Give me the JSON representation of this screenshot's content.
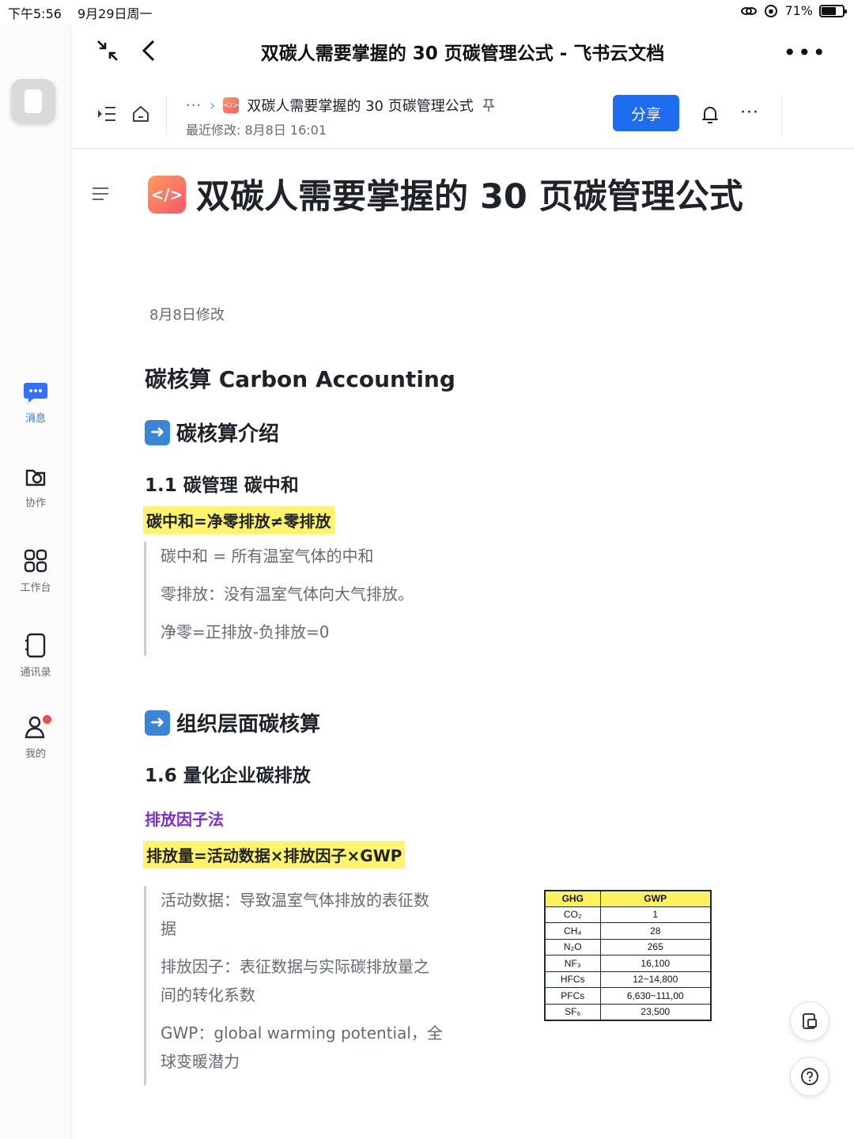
{
  "status_bar": {
    "time": "下午5:56",
    "date": "9月29日周一",
    "battery": "71%",
    "battery_level": 0.71
  },
  "window": {
    "title": "双碳人需要掌握的 30 页碳管理公式 - 飞书云文档"
  },
  "rail": {
    "items": [
      {
        "label": "消息",
        "icon": "message-icon",
        "active": true
      },
      {
        "label": "协作",
        "icon": "collaborate-icon"
      },
      {
        "label": "工作台",
        "icon": "workspace-grid-icon"
      },
      {
        "label": "通讯录",
        "icon": "contacts-icon"
      },
      {
        "label": "我的",
        "icon": "profile-icon",
        "badge": true
      }
    ]
  },
  "toolbar": {
    "breadcrumb_ellipsis": "···",
    "doc_name": "双碳人需要掌握的 30 页碳管理公式",
    "last_modified": "最近修改: 8月8日 16:01",
    "share_label": "分享",
    "more": "···"
  },
  "doc": {
    "icon_text": "</>",
    "title": "双碳人需要掌握的 30 页碳管理公式",
    "date": "8月8日修改",
    "h2": "碳核算 Carbon Accounting",
    "section1": "碳核算介绍",
    "sub11": "1.1 碳管理 碳中和",
    "highlight1": "碳中和=净零排放≠零排放",
    "quote1": [
      "碳中和 = 所有温室气体的中和",
      "零排放：没有温室气体向大气排放。",
      "净零=正排放-负排放=0"
    ],
    "section2": "组织层面碳核算",
    "sub16": "1.6 量化企业碳排放",
    "method": "排放因子法",
    "highlight2": "排放量=活动数据×排放因子×GWP",
    "quote2": [
      "活动数据：导致温室气体排放的表征数据",
      "排放因子：表征数据与实际碳排放量之间的转化系数",
      "GWP：global warming potential，全球变暖潜力"
    ],
    "table": {
      "headers": [
        "GHG",
        "GWP"
      ],
      "rows": [
        [
          "CO₂",
          "1"
        ],
        [
          "CH₄",
          "28"
        ],
        [
          "N₂O",
          "265"
        ],
        [
          "NF₃",
          "16,100"
        ],
        [
          "HFCs",
          "12~14,800"
        ],
        [
          "PFCs",
          "6,630~111,00"
        ],
        [
          "SF₆",
          "23,500"
        ]
      ]
    }
  }
}
